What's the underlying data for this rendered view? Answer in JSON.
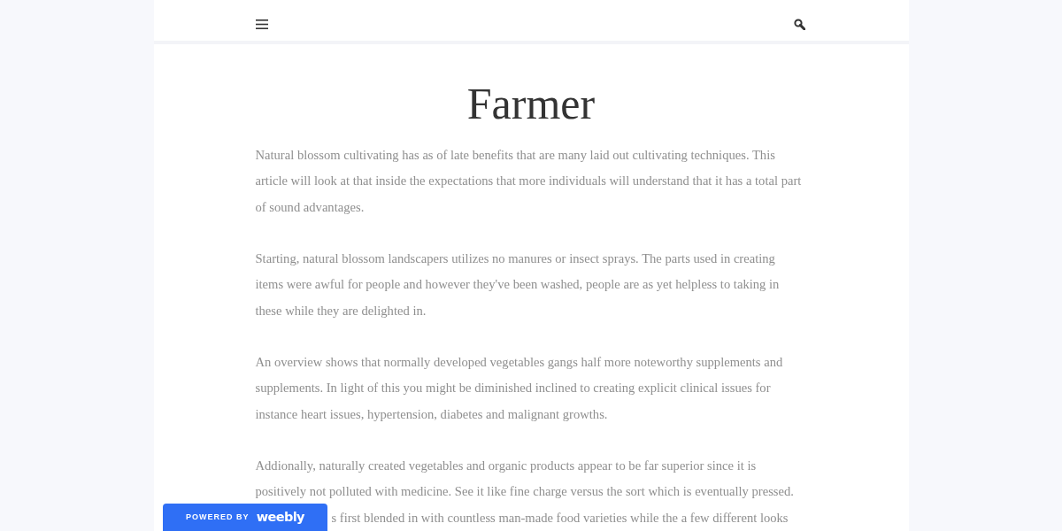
{
  "article": {
    "title": "Farmer",
    "paragraphs": [
      {
        "lines": [
          "Natural blossom cultivating has as of late benefits that are many laid out cultivating techniques. This",
          "article will look at that inside the expectations that more individuals will understand that it has a total part",
          "of sound advantages."
        ]
      },
      {
        "lines": [
          "Starting, natural blossom landscapers utilizes no manures or insect sprays. The parts used in creating",
          "items were awful for people and however they've been washed, people are as yet helpless to taking in",
          "these while they are delighted in."
        ]
      },
      {
        "lines": [
          "An overview shows that normally developed vegetables gangs half more noteworthy supplements and",
          "supplements. In light of this you might be diminished inclined to creating explicit clinical issues for",
          "instance heart issues, hypertension, diabetes and malignant growths."
        ]
      },
      {
        "lines": [
          "Addionally, naturally created vegetables and organic products appear to be far superior since it is",
          "positively not polluted with medicine. See it like fine charge versus the sort which is eventually pressed."
        ]
      }
    ],
    "covered_line": "s first blended in with countless man-made food varieties while the a few different looks"
  },
  "badge": {
    "label": "POWERED BY",
    "brand": "weebly"
  }
}
